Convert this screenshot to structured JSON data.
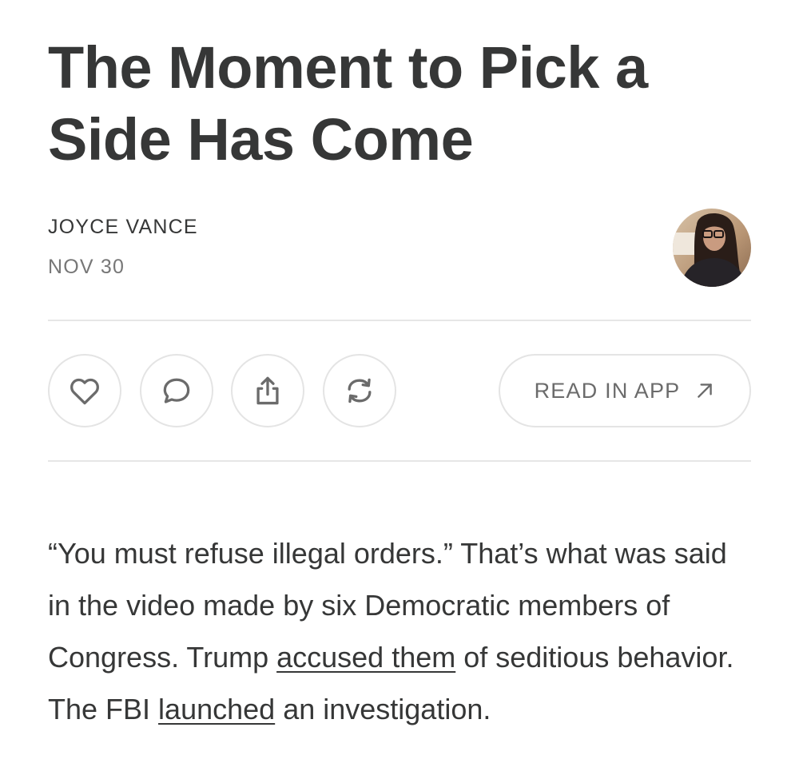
{
  "post": {
    "title": "The Moment to Pick a Side Has Come",
    "author": "JOYCE VANCE",
    "date": "NOV 30"
  },
  "actions": {
    "like_icon": "heart-icon",
    "comment_icon": "comment-bubble-icon",
    "share_icon": "share-icon",
    "restack_icon": "restack-icon",
    "read_in_app_label": "READ IN APP",
    "read_in_app_icon": "arrow-up-right-icon"
  },
  "body": {
    "p1_text_1": "“You must refuse illegal orders.” That’s what was said in the video made by six Democratic members of Congress. Trump ",
    "p1_link_1": "accused them",
    "p1_text_2": " of seditious behavior. The FBI ",
    "p1_link_2": "launched",
    "p1_text_3": " an investigation."
  },
  "colors": {
    "text": "#363737",
    "muted": "#777777",
    "border": "#e4e4e4"
  }
}
